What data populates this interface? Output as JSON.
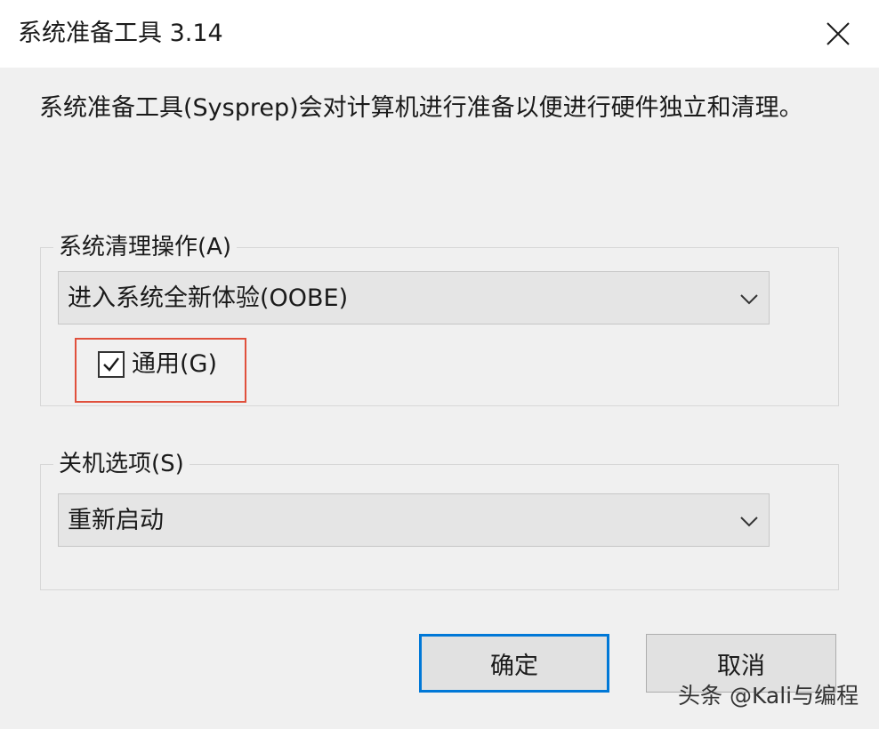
{
  "window": {
    "title": "系统准备工具 3.14"
  },
  "description": "系统准备工具(Sysprep)会对计算机进行准备以便进行硬件独立和清理。",
  "cleanup_group": {
    "legend": "系统清理操作(A)",
    "selected_option": "进入系统全新体验(OOBE)",
    "generalize": {
      "label": "通用(G)",
      "checked": true
    }
  },
  "shutdown_group": {
    "legend": "关机选项(S)",
    "selected_option": "重新启动"
  },
  "buttons": {
    "ok_label": "确定",
    "cancel_label": "取消"
  },
  "watermark": "头条 @Kali与编程",
  "colors": {
    "accent": "#0078d7",
    "highlight": "#e0503c"
  },
  "icons": {
    "close": "close-icon",
    "dropdown": "chevron-down-icon",
    "check": "checkmark-icon"
  }
}
